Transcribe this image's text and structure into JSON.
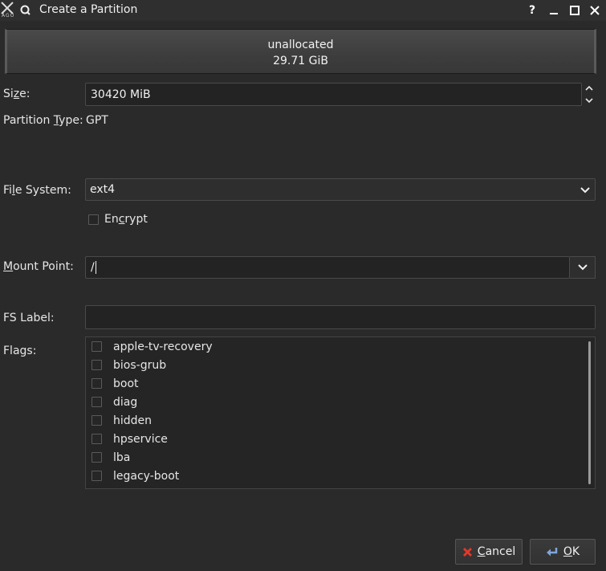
{
  "window": {
    "title": "Create a Partition",
    "logo_text": "AGO",
    "controls": [
      "help-icon",
      "minimize-icon",
      "maximize-icon",
      "close-icon"
    ]
  },
  "partition_bar": {
    "name": "unallocated",
    "size": "29.71 GiB"
  },
  "size": {
    "label_prefix": "Si",
    "label_accel": "z",
    "label_suffix": "e:",
    "value": "30420 MiB"
  },
  "partition_type": {
    "label_prefix": "Partition ",
    "label_accel": "T",
    "label_suffix": "ype:",
    "value": "GPT"
  },
  "file_system": {
    "label_prefix": "Fi",
    "label_accel": "l",
    "label_suffix": "e System:",
    "selected": "ext4"
  },
  "encrypt": {
    "label_prefix": "En",
    "label_accel": "c",
    "label_suffix": "rypt",
    "checked": false
  },
  "mount_point": {
    "label_prefix": "",
    "label_accel": "M",
    "label_suffix": "ount Point:",
    "value": "/"
  },
  "fs_label": {
    "label": "FS Label:",
    "value": ""
  },
  "flags": {
    "label": "Flags:",
    "items": [
      {
        "label": "apple-tv-recovery",
        "checked": false
      },
      {
        "label": "bios-grub",
        "checked": false
      },
      {
        "label": "boot",
        "checked": false
      },
      {
        "label": "diag",
        "checked": false
      },
      {
        "label": "hidden",
        "checked": false
      },
      {
        "label": "hpservice",
        "checked": false
      },
      {
        "label": "lba",
        "checked": false
      },
      {
        "label": "legacy-boot",
        "checked": false
      }
    ]
  },
  "buttons": {
    "cancel_accel": "C",
    "cancel_rest": "ancel",
    "ok_accel": "O",
    "ok_rest": "K"
  },
  "colors": {
    "background": "#2a2a2a",
    "cancel_icon": "#e0392b",
    "ok_icon": "#7fa6d8"
  }
}
